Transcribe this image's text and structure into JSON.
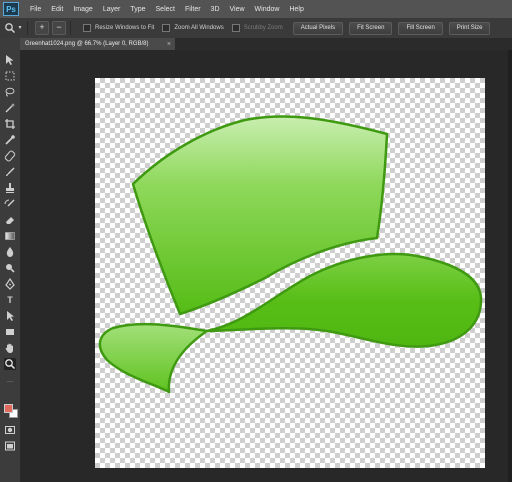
{
  "app": {
    "logo": "Ps"
  },
  "menu": [
    "File",
    "Edit",
    "Image",
    "Layer",
    "Type",
    "Select",
    "Filter",
    "3D",
    "View",
    "Window",
    "Help"
  ],
  "options": {
    "tool_icon": "zoom-icon",
    "zoom_in": "+",
    "zoom_out": "−",
    "resize_windows": "Resize Windows to Fit",
    "zoom_all": "Zoom All Windows",
    "scrubby": "Scrubby Zoom",
    "buttons": [
      "Actual Pixels",
      "Fit Screen",
      "Fill Screen",
      "Print Size"
    ]
  },
  "document": {
    "tab_title": "Greenhat1024.png @ 66.7% (Layer 0, RGB/8)",
    "close": "×"
  },
  "colors": {
    "foreground": "#e06a5e",
    "background": "#ffffff",
    "hat_green": "#5cbf1e"
  },
  "tools": [
    "move-icon",
    "marquee-icon",
    "lasso-icon",
    "magic-wand-icon",
    "crop-icon",
    "eyedropper-icon",
    "spot-healing-icon",
    "brush-icon",
    "clone-stamp-icon",
    "history-brush-icon",
    "eraser-icon",
    "gradient-icon",
    "blur-icon",
    "dodge-icon",
    "pen-icon",
    "type-icon",
    "path-selection-icon",
    "rectangle-icon",
    "hand-icon",
    "zoom-tool-icon"
  ]
}
